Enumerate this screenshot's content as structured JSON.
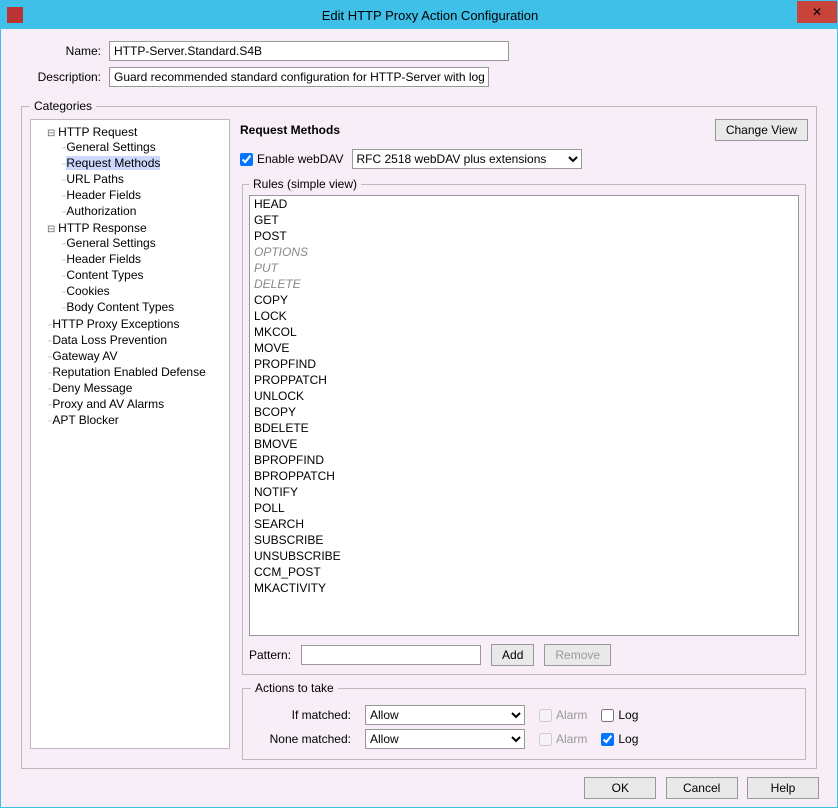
{
  "window": {
    "title": "Edit HTTP Proxy Action Configuration",
    "close": "✕"
  },
  "form": {
    "name_label": "Name:",
    "name_value": "HTTP-Server.Standard.S4B",
    "desc_label": "Description:",
    "desc_value": "Guard recommended standard configuration for HTTP-Server with logging enabled"
  },
  "categories": {
    "legend": "Categories",
    "http_request": "HTTP Request",
    "req_general": "General Settings",
    "req_methods": "Request Methods",
    "req_urlpaths": "URL Paths",
    "req_headers": "Header Fields",
    "req_auth": "Authorization",
    "http_response": "HTTP Response",
    "res_general": "General Settings",
    "res_headers": "Header Fields",
    "res_content": "Content Types",
    "res_cookies": "Cookies",
    "res_body": "Body Content Types",
    "proxy_exceptions": "HTTP Proxy Exceptions",
    "dlp": "Data Loss Prevention",
    "gatewayav": "Gateway AV",
    "red": "Reputation Enabled Defense",
    "deny": "Deny Message",
    "alarms": "Proxy and AV Alarms",
    "apt": "APT Blocker"
  },
  "pane": {
    "title": "Request Methods",
    "change_view": "Change View",
    "enable_webdav": "Enable webDAV",
    "webdav_mode": "RFC 2518 webDAV plus extensions"
  },
  "rules": {
    "legend": "Rules (simple view)",
    "items": [
      {
        "t": "HEAD"
      },
      {
        "t": "GET"
      },
      {
        "t": "POST"
      },
      {
        "t": "OPTIONS",
        "dim": true
      },
      {
        "t": "PUT",
        "dim": true
      },
      {
        "t": "DELETE",
        "dim": true
      },
      {
        "t": "COPY"
      },
      {
        "t": "LOCK"
      },
      {
        "t": "MKCOL"
      },
      {
        "t": "MOVE"
      },
      {
        "t": "PROPFIND"
      },
      {
        "t": "PROPPATCH"
      },
      {
        "t": "UNLOCK"
      },
      {
        "t": "BCOPY"
      },
      {
        "t": "BDELETE"
      },
      {
        "t": "BMOVE"
      },
      {
        "t": "BPROPFIND"
      },
      {
        "t": "BPROPPATCH"
      },
      {
        "t": "NOTIFY"
      },
      {
        "t": "POLL"
      },
      {
        "t": "SEARCH"
      },
      {
        "t": "SUBSCRIBE"
      },
      {
        "t": "UNSUBSCRIBE"
      },
      {
        "t": "CCM_POST"
      },
      {
        "t": "MKACTIVITY"
      }
    ],
    "pattern_label": "Pattern:",
    "add": "Add",
    "remove": "Remove"
  },
  "actions": {
    "legend": "Actions to take",
    "if_matched_label": "If matched:",
    "none_matched_label": "None matched:",
    "allow_option": "Allow",
    "alarm_label": "Alarm",
    "log_label": "Log"
  },
  "buttons": {
    "ok": "OK",
    "cancel": "Cancel",
    "help": "Help"
  }
}
